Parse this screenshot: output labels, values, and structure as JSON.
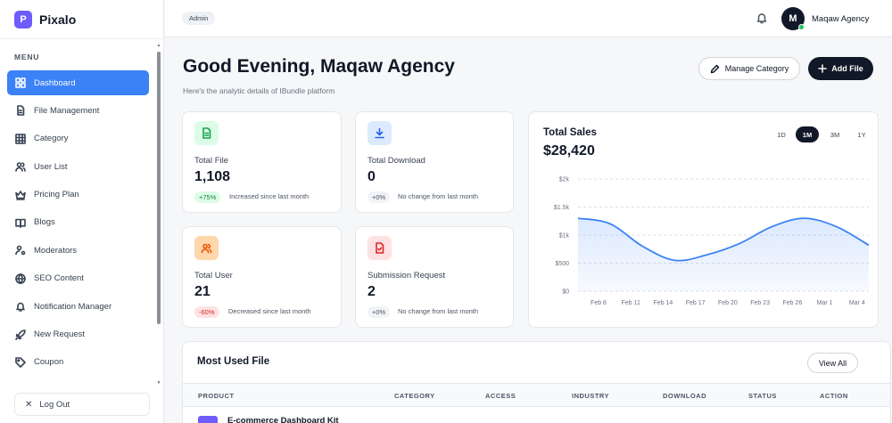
{
  "brand": {
    "logo_letter": "P",
    "name": "Pixalo"
  },
  "sidebar": {
    "menu_label": "MENU",
    "items": [
      {
        "label": "Dashboard",
        "icon": "dashboard-grid-icon",
        "active": true
      },
      {
        "label": "File Management",
        "icon": "file-icon"
      },
      {
        "label": "Category",
        "icon": "table-grid-icon"
      },
      {
        "label": "User List",
        "icon": "users-icon"
      },
      {
        "label": "Pricing Plan",
        "icon": "crown-icon"
      },
      {
        "label": "Blogs",
        "icon": "book-icon"
      },
      {
        "label": "Moderators",
        "icon": "user-gear-icon"
      },
      {
        "label": "SEO Content",
        "icon": "globe-icon"
      },
      {
        "label": "Notification Manager",
        "icon": "bell-icon"
      },
      {
        "label": "New Request",
        "icon": "rocket-icon"
      },
      {
        "label": "Coupon",
        "icon": "tag-icon"
      }
    ],
    "logout_label": "Log Out"
  },
  "header": {
    "role": "Admin",
    "avatar_letter": "M",
    "user_name": "Maqaw Agency"
  },
  "main": {
    "greeting": "Good Evening, Maqaw Agency",
    "subtitle": "Here's the analytic details of IBundle platform",
    "manage_category_label": "Manage Category",
    "add_file_label": "Add File"
  },
  "stats": [
    {
      "label": "Total File",
      "value": "1,108",
      "badge": "+75%",
      "badge_tone": "up",
      "note": "Increased since last month",
      "icon": "document-icon"
    },
    {
      "label": "Total Download",
      "value": "0",
      "badge": "+0%",
      "badge_tone": "neutral",
      "note": "No change from last month",
      "icon": "download-icon"
    },
    {
      "label": "Total User",
      "value": "21",
      "badge": "-60%",
      "badge_tone": "down",
      "note": "Decreased since last month",
      "icon": "users-icon"
    },
    {
      "label": "Submission Request",
      "value": "2",
      "badge": "+0%",
      "badge_tone": "neutral",
      "note": "No change from last month",
      "icon": "file-check-icon"
    }
  ],
  "colors": {
    "accent": "#3b82f6",
    "up_bg": "#dcfce7",
    "up_fg": "#15803d",
    "down_bg": "#fee2e2",
    "down_fg": "#dc2626",
    "neutral_bg": "#f1f3f6",
    "neutral_fg": "#4b5563"
  },
  "sales": {
    "title": "Total Sales",
    "value": "$28,420",
    "ranges": [
      "1D",
      "1M",
      "3M",
      "1Y"
    ],
    "active_range": "1M"
  },
  "chart_data": {
    "type": "area",
    "title": "Total Sales",
    "x": [
      "Feb 8",
      "Feb 11",
      "Feb 14",
      "Feb 17",
      "Feb 20",
      "Feb 23",
      "Feb 26",
      "Mar 1",
      "Mar 4",
      "Mar 7"
    ],
    "values": [
      1300,
      1200,
      800,
      550,
      650,
      850,
      1150,
      1300,
      1150,
      820
    ],
    "y_ticks": [
      "$0",
      "$500",
      "$1k",
      "$1.5k",
      "$2k"
    ],
    "ylim": [
      0,
      2000
    ],
    "grid": true,
    "xlabel": "",
    "ylabel": ""
  },
  "table": {
    "title": "Most Used File",
    "view_all_label": "View All",
    "columns": [
      "PRODUCT",
      "CATEGORY",
      "ACCESS",
      "INDUSTRY",
      "DOWNLOAD",
      "STATUS",
      "ACTION"
    ],
    "rows": [
      {
        "product": "E-commerce Dashboard Kit"
      }
    ]
  }
}
